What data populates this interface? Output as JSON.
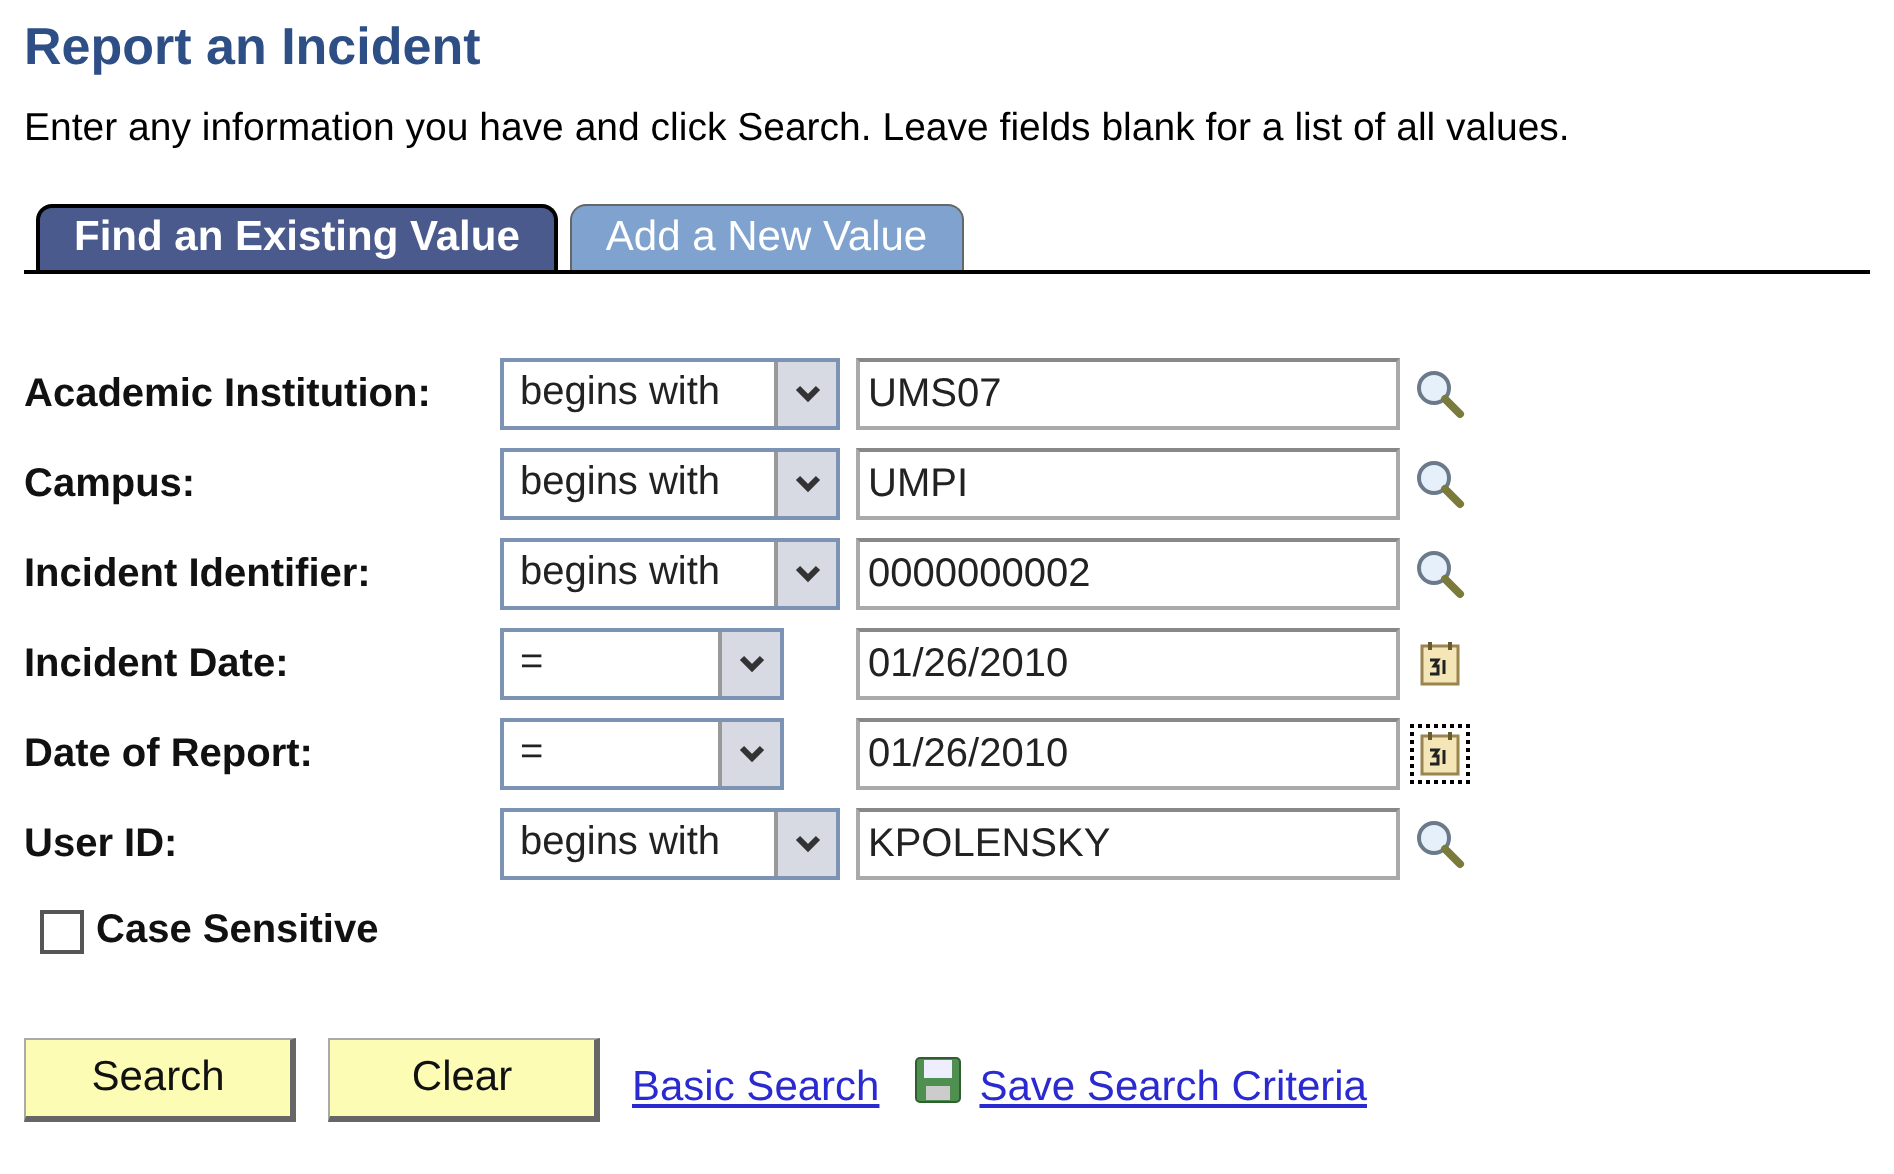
{
  "page": {
    "title": "Report an Incident",
    "instructions": "Enter any information you have and click Search. Leave fields blank for a list of all values."
  },
  "tabs": [
    {
      "label": "Find an Existing Value",
      "selected": true
    },
    {
      "label": "Add a New Value",
      "selected": false
    }
  ],
  "criteria": [
    {
      "label": "Academic Institution:",
      "operator": "begins with",
      "value": "UMS07",
      "kind": "lookup",
      "focused": false
    },
    {
      "label": "Campus:",
      "operator": "begins with",
      "value": "UMPI",
      "kind": "lookup",
      "focused": false
    },
    {
      "label": "Incident Identifier:",
      "operator": "begins with",
      "value": "0000000002",
      "kind": "lookup",
      "focused": false
    },
    {
      "label": "Incident Date:",
      "operator": "=",
      "value": "01/26/2010",
      "kind": "date",
      "focused": false
    },
    {
      "label": "Date of Report:",
      "operator": "=",
      "value": "01/26/2010",
      "kind": "date",
      "focused": true
    },
    {
      "label": "User ID:",
      "operator": "begins with",
      "value": "KPOLENSKY",
      "kind": "lookup",
      "focused": false
    }
  ],
  "case_sensitive": {
    "label": "Case Sensitive",
    "checked": false
  },
  "buttons": [
    "Search",
    "Clear"
  ],
  "links": {
    "basic_search": "Basic Search",
    "save_criteria": "Save Search Criteria"
  }
}
